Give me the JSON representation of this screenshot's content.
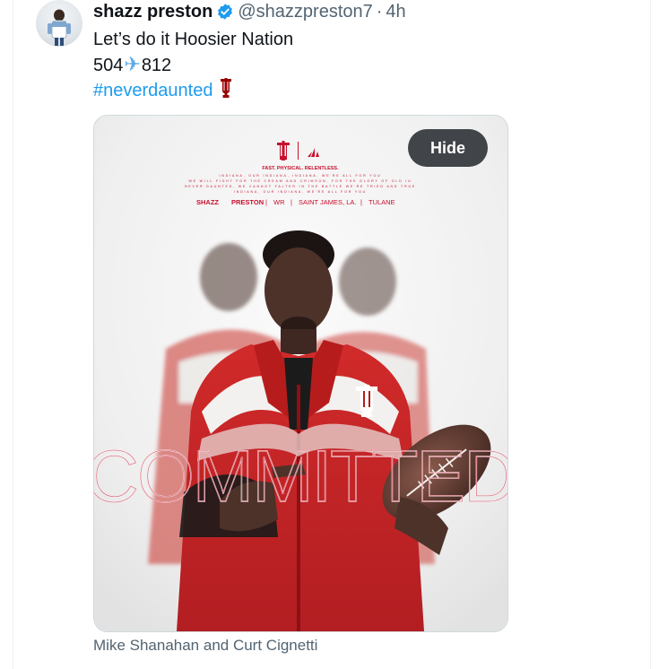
{
  "author": {
    "display_name": "shazz preston",
    "handle": "@shazzpreston7",
    "separator": "·",
    "time": "4h",
    "verified": true,
    "verified_color": "#1d9bf0"
  },
  "tweet": {
    "line1": "Let’s do it Hoosier Nation",
    "line2_prefix": "504",
    "line2_icon": "airplane-emoji",
    "line2_suffix": "812",
    "hashtag": "#neverdaunted",
    "hashtag_icon": "indiana-iu-logo"
  },
  "media": {
    "tagline": "FAST. PHYSICAL. RELENTLESS.",
    "brand_icons": [
      "indiana-iu-logo",
      "adidas-logo"
    ],
    "fine_print": [
      "INDIANA, OUR INDIANA, INDIANA, WE'RE ALL FOR YOU",
      "WE WILL FIGHT FOR THE CREAM AND CRIMSON, FOR THE GLORY OF OLD IU",
      "NEVER DAUNTED, WE CANNOT FALTER IN THE BATTLE WE'RE TRIED AND TRUE",
      "INDIANA, OUR INDIANA, WE'RE ALL FOR YOU"
    ],
    "player_first": "SHAZZ",
    "player_last": "PRESTON",
    "position": "WR",
    "hometown": "SAINT JAMES, LA.",
    "previous_school": "TULANE",
    "watermark": "COMMITTED",
    "hide_label": "Hide",
    "accent_color": "#c8102e"
  },
  "caption": "Mike Shanahan and Curt Cignetti"
}
